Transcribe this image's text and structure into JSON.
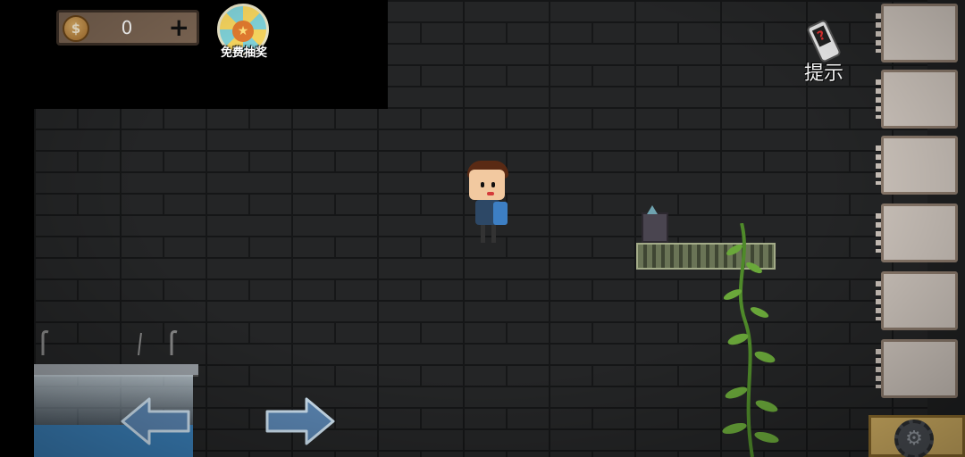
{
  "hud": {
    "coin_icon_symbol": "$",
    "coin_count": "0",
    "add_coins_symbol": "+",
    "lottery_label": "免费抽奖",
    "hint_label": "提示",
    "hint_icon_symbol": "?",
    "settings_icon_symbol": "⚙"
  },
  "inventory": {
    "slots": [
      "",
      "",
      "",
      "",
      "",
      ""
    ]
  },
  "controls": {
    "move_left": "←",
    "move_right": "→"
  },
  "colors": {
    "wall": "#242526",
    "coin_panel": "#7a6452",
    "settings_panel": "#d8b566",
    "arrow_fill": "#5b86b3",
    "vine": "#6aa83a"
  }
}
